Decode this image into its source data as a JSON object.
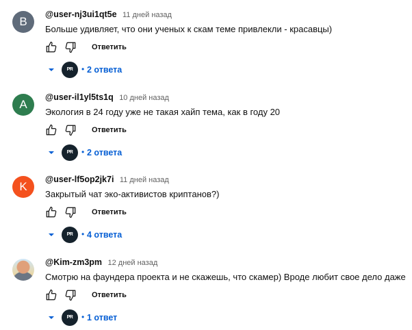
{
  "actions": {
    "reply_label": "Ответить"
  },
  "replier_avatar_text": "PR",
  "comments": [
    {
      "author": "@user-nj3ui1qt5e",
      "time": "11 дней назад",
      "text": "Больше удивляет, что они ученых к скам теме привлекли - красавцы)",
      "avatar_letter": "B",
      "avatar_color": "#5f6b7a",
      "replies_label": "2 ответа"
    },
    {
      "author": "@user-il1yl5ts1q",
      "time": "10 дней назад",
      "text": "Экология в 24 году уже не такая хайп тема, как в году 20",
      "avatar_letter": "A",
      "avatar_color": "#2e7d4f",
      "replies_label": "2 ответа"
    },
    {
      "author": "@user-lf5op2jk7i",
      "time": "11 дней назад",
      "text": "Закрытый чат эко-активистов криптанов?)",
      "avatar_letter": "K",
      "avatar_color": "#f4511e",
      "replies_label": "4 ответа"
    },
    {
      "author": "@Kim-zm3pm",
      "time": "12 дней назад",
      "text": "Смотрю на фаундера проекта и не скажешь, что скамер) Вроде любит свое дело даже",
      "avatar_letter": "",
      "avatar_color": "",
      "replies_label": "1 ответ"
    }
  ]
}
